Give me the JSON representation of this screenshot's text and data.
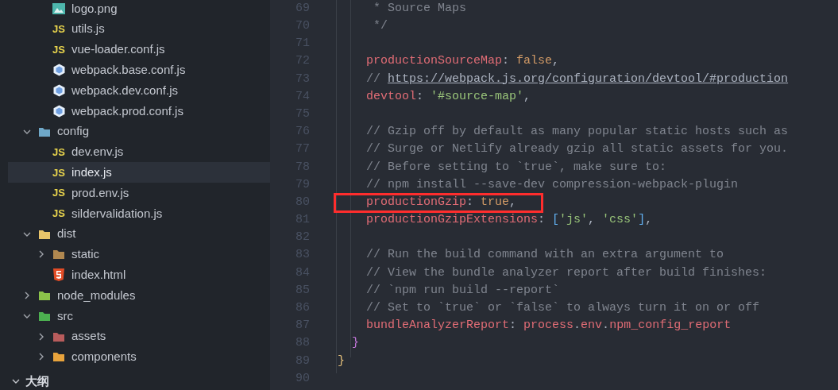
{
  "explorer": {
    "tree": [
      {
        "children": [
          {
            "label": "logo.png",
            "kind": "image",
            "selected": false
          },
          {
            "label": "utils.js",
            "kind": "js",
            "badge": "JS",
            "selected": false
          },
          {
            "label": "vue-loader.conf.js",
            "kind": "js",
            "badge": "JS",
            "selected": false
          },
          {
            "label": "webpack.base.conf.js",
            "kind": "webpack",
            "selected": false
          },
          {
            "label": "webpack.dev.conf.js",
            "kind": "webpack",
            "selected": false
          },
          {
            "label": "webpack.prod.conf.js",
            "kind": "webpack",
            "selected": false
          }
        ]
      },
      {
        "label": "config",
        "kind": "folder",
        "color": "#6fa8c8",
        "expanded": true,
        "selected": false,
        "children": [
          {
            "label": "dev.env.js",
            "kind": "js",
            "badge": "JS",
            "selected": false
          },
          {
            "label": "index.js",
            "kind": "js",
            "badge": "JS",
            "selected": true
          },
          {
            "label": "prod.env.js",
            "kind": "js",
            "badge": "JS",
            "selected": false
          },
          {
            "label": "sildervalidation.js",
            "kind": "js",
            "badge": "JS",
            "selected": false
          }
        ]
      },
      {
        "label": "dist",
        "kind": "folder",
        "color": "#e8c46a",
        "expanded": true,
        "selected": false,
        "children": [
          {
            "label": "static",
            "kind": "folder",
            "color": "#b08850",
            "expanded": false,
            "selected": false
          },
          {
            "label": "index.html",
            "kind": "html",
            "selected": false
          }
        ]
      },
      {
        "label": "node_modules",
        "kind": "folder",
        "color": "#8bc34a",
        "expanded": false,
        "selected": false
      },
      {
        "label": "src",
        "kind": "folder",
        "color": "#4caf50",
        "expanded": true,
        "selected": false,
        "children": [
          {
            "label": "assets",
            "kind": "folder",
            "color": "#b85c5c",
            "expanded": false,
            "selected": false
          },
          {
            "label": "components",
            "kind": "folder",
            "color": "#e8a33c",
            "expanded": false,
            "selected": false
          }
        ]
      }
    ]
  },
  "outline": {
    "title": "大纲",
    "expanded": true
  },
  "editor": {
    "lines": [
      {
        "number": "69",
        "tokens": [
          {
            "t": "     * Source Maps",
            "kind": "comment"
          }
        ]
      },
      {
        "number": "70",
        "tokens": [
          {
            "t": "     */",
            "kind": "comment"
          }
        ]
      },
      {
        "number": "71"
      },
      {
        "number": "72",
        "tokens": [
          {
            "t": "    productionSourceMap",
            "kind": "key"
          },
          {
            "t": ": ",
            "kind": "punct"
          },
          {
            "t": "false",
            "kind": "literal"
          },
          {
            "t": ",",
            "kind": "punct"
          }
        ]
      },
      {
        "number": "73",
        "tokens": [
          {
            "t": "    // ",
            "kind": "comment"
          },
          {
            "t": "https://webpack.js.org/configuration/devtool/#production",
            "kind": "link"
          }
        ]
      },
      {
        "number": "74",
        "tokens": [
          {
            "t": "    devtool",
            "kind": "key"
          },
          {
            "t": ": ",
            "kind": "punct"
          },
          {
            "t": "'#source-map'",
            "kind": "string"
          },
          {
            "t": ",",
            "kind": "punct"
          }
        ]
      },
      {
        "number": "75"
      },
      {
        "number": "76",
        "tokens": [
          {
            "t": "    // Gzip off by default as many popular static hosts such as",
            "kind": "comment"
          }
        ]
      },
      {
        "number": "77",
        "tokens": [
          {
            "t": "    // Surge or Netlify already gzip all static assets for you.",
            "kind": "comment"
          }
        ]
      },
      {
        "number": "78",
        "tokens": [
          {
            "t": "    // Before setting to `true`, make sure to:",
            "kind": "comment"
          }
        ]
      },
      {
        "number": "79",
        "tokens": [
          {
            "t": "    // npm install --save-dev compression-webpack-plugin",
            "kind": "comment"
          }
        ]
      },
      {
        "number": "80",
        "annotated": true,
        "tokens": [
          {
            "t": "    productionGzip",
            "kind": "key"
          },
          {
            "t": ": ",
            "kind": "punct"
          },
          {
            "t": "true",
            "kind": "literal"
          },
          {
            "t": ",",
            "kind": "punct"
          }
        ]
      },
      {
        "number": "81",
        "tokens": [
          {
            "t": "    productionGzipExtensions",
            "kind": "key"
          },
          {
            "t": ": ",
            "kind": "punct"
          },
          {
            "t": "[",
            "kind": "bracket"
          },
          {
            "t": "'js'",
            "kind": "string"
          },
          {
            "t": ", ",
            "kind": "punct"
          },
          {
            "t": "'css'",
            "kind": "string"
          },
          {
            "t": "]",
            "kind": "bracket"
          },
          {
            "t": ",",
            "kind": "punct"
          }
        ]
      },
      {
        "number": "82"
      },
      {
        "number": "83",
        "tokens": [
          {
            "t": "    // Run the build command with an extra argument to",
            "kind": "comment"
          }
        ]
      },
      {
        "number": "84",
        "tokens": [
          {
            "t": "    // View the bundle analyzer report after build finishes:",
            "kind": "comment"
          }
        ]
      },
      {
        "number": "85",
        "tokens": [
          {
            "t": "    // `npm run build --report`",
            "kind": "comment"
          }
        ]
      },
      {
        "number": "86",
        "tokens": [
          {
            "t": "    // Set to `true` or `false` to always turn it on or off",
            "kind": "comment"
          }
        ]
      },
      {
        "number": "87",
        "tokens": [
          {
            "t": "    bundleAnalyzerReport",
            "kind": "key"
          },
          {
            "t": ": ",
            "kind": "punct"
          },
          {
            "t": "process",
            "kind": "key"
          },
          {
            "t": ".",
            "kind": "punct"
          },
          {
            "t": "env",
            "kind": "key"
          },
          {
            "t": ".",
            "kind": "punct"
          },
          {
            "t": "npm_config_report",
            "kind": "key"
          }
        ]
      },
      {
        "number": "88",
        "tokens": [
          {
            "t": "  }",
            "kind": "brace2"
          }
        ]
      },
      {
        "number": "89",
        "tokens": [
          {
            "t": "}",
            "kind": "brace1"
          }
        ]
      },
      {
        "number": "90"
      }
    ]
  }
}
